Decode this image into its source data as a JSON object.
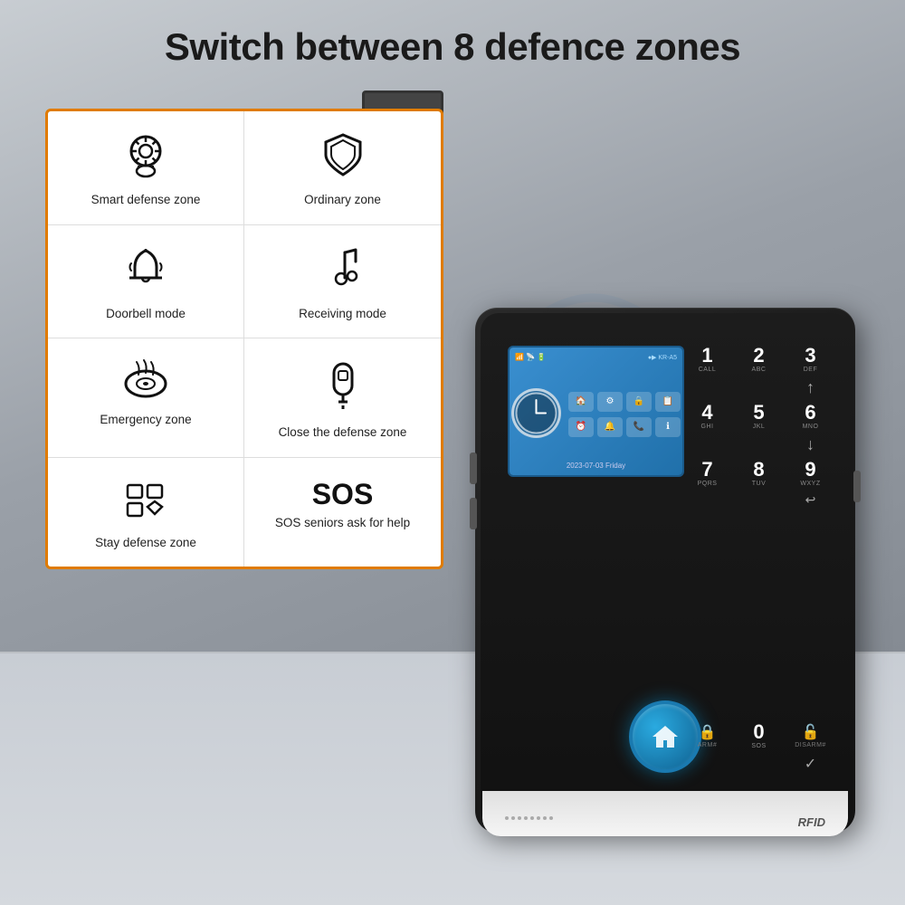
{
  "title": "Switch between 8 defence zones",
  "zones": [
    {
      "id": "smart-defense",
      "icon": "🧠⚙",
      "iconType": "brain-gear",
      "label": "Smart defense zone"
    },
    {
      "id": "ordinary-zone",
      "icon": "🛡",
      "iconType": "shield",
      "label": "Ordinary zone"
    },
    {
      "id": "doorbell-mode",
      "icon": "🔔",
      "iconType": "bell",
      "label": "Doorbell mode"
    },
    {
      "id": "receiving-mode",
      "icon": "♪",
      "iconType": "music-note",
      "label": "Receiving mode"
    },
    {
      "id": "emergency-zone",
      "icon": "🚨",
      "iconType": "smoke-detector",
      "label": "Emergency zone"
    },
    {
      "id": "close-defense",
      "icon": "🔑",
      "iconType": "key",
      "label": "Close the defense zone"
    },
    {
      "id": "stay-defense",
      "icon": "⊞",
      "iconType": "stay-icons",
      "label": "Stay defense zone"
    },
    {
      "id": "sos",
      "icon": "SOS",
      "iconType": "sos-text",
      "label": "SOS seniors ask for help"
    }
  ],
  "keypad": {
    "keys": [
      {
        "num": "1",
        "letters": "CALL"
      },
      {
        "num": "2",
        "letters": "ABC"
      },
      {
        "num": "3",
        "letters": "DEF"
      },
      {
        "num": "↑",
        "letters": ""
      },
      {
        "num": "4",
        "letters": "GHI"
      },
      {
        "num": "5",
        "letters": "JKL"
      },
      {
        "num": "6",
        "letters": "MNO"
      },
      {
        "num": "↓",
        "letters": ""
      },
      {
        "num": "7",
        "letters": "PQRS"
      },
      {
        "num": "8",
        "letters": "TUV"
      },
      {
        "num": "9",
        "letters": "WXYZ"
      },
      {
        "num": "↩",
        "letters": ""
      },
      {
        "num": "🔒",
        "letters": "ARM#"
      },
      {
        "num": "0",
        "letters": "SOS"
      },
      {
        "num": "🔓",
        "letters": "DISARM#"
      },
      {
        "num": "✓",
        "letters": ""
      }
    ]
  },
  "device": {
    "rfid_label": "RFID",
    "lcd_date": "2023-07-03  Friday"
  }
}
